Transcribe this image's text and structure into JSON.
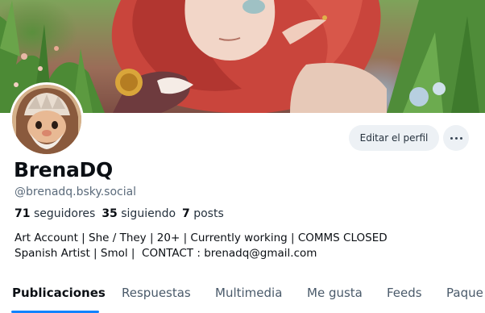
{
  "profile": {
    "display_name": "BrenaDQ",
    "handle": "@brenadq.bsky.social",
    "stats": {
      "followers_count": "71",
      "followers_label": "seguidores",
      "following_count": "35",
      "following_label": "siguiendo",
      "posts_count": "7",
      "posts_label": "posts"
    },
    "bio_line1": "Art Account | She / They | 20+ | Currently working | COMMS CLOSED",
    "bio_line2": "Spanish Artist | Smol |  CONTACT : brenadq@gmail.com"
  },
  "actions": {
    "edit_profile_label": "Editar el perfil",
    "more_icon": "ellipsis-icon"
  },
  "tabs": [
    {
      "label": "Publicaciones",
      "active": true
    },
    {
      "label": "Respuestas",
      "active": false
    },
    {
      "label": "Multimedia",
      "active": false
    },
    {
      "label": "Me gusta",
      "active": false
    },
    {
      "label": "Feeds",
      "active": false
    },
    {
      "label": "Paque",
      "active": false
    }
  ],
  "colors": {
    "accent": "#1083fe",
    "button_bg": "#edf1f5",
    "text_primary": "#0b0f14",
    "text_secondary": "#5b6b7b"
  }
}
